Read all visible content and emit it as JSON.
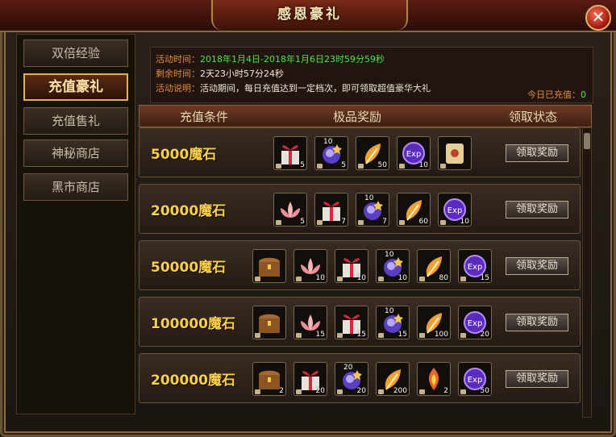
{
  "window": {
    "title": "感恩豪礼",
    "close_symbol": "✕"
  },
  "sidebar": {
    "items": [
      {
        "label": "双倍经验"
      },
      {
        "label": "充值豪礼",
        "active": true
      },
      {
        "label": "充值售礼"
      },
      {
        "label": "神秘商店"
      },
      {
        "label": "黑市商店"
      }
    ]
  },
  "info": {
    "time_label": "活动时间：",
    "time_value": "2018年1月4日-2018年1月6日23时59分59秒",
    "remain_label": "剩余时间：",
    "remain_value": "2天23小时57分24秒",
    "desc_label": "活动说明：",
    "desc_value": "活动期间，每日充值达到一定档次，即可领取超值豪华大礼",
    "today_label": "今日已充值：",
    "today_value": "0"
  },
  "table": {
    "headers": [
      "充值条件",
      "极品奖励",
      "领取状态"
    ],
    "claim_label": "领取奖励",
    "rows": [
      {
        "condition": "5000魔石",
        "items": [
          {
            "icon": "gift-box-icon",
            "count": "5"
          },
          {
            "icon": "soul-orb-icon",
            "count": "5",
            "level": "10"
          },
          {
            "icon": "feather-icon",
            "count": "50"
          },
          {
            "icon": "exp-orb-icon",
            "count": "10"
          },
          {
            "icon": "scroll-icon",
            "count": ""
          }
        ]
      },
      {
        "condition": "20000魔石",
        "items": [
          {
            "icon": "lotus-icon",
            "count": "5"
          },
          {
            "icon": "gift-box-icon",
            "count": "7"
          },
          {
            "icon": "soul-orb-icon",
            "count": "7",
            "level": "10"
          },
          {
            "icon": "feather-icon",
            "count": "60"
          },
          {
            "icon": "exp-orb-icon",
            "count": "10"
          }
        ]
      },
      {
        "condition": "50000魔石",
        "items": [
          {
            "icon": "treasure-chest-icon",
            "count": ""
          },
          {
            "icon": "lotus-icon",
            "count": "10"
          },
          {
            "icon": "gift-box-icon",
            "count": "10"
          },
          {
            "icon": "soul-orb-icon",
            "count": "10",
            "level": "10"
          },
          {
            "icon": "feather-icon",
            "count": "80"
          },
          {
            "icon": "exp-orb-icon",
            "count": "15"
          }
        ]
      },
      {
        "condition": "100000魔石",
        "items": [
          {
            "icon": "treasure-chest-icon",
            "count": ""
          },
          {
            "icon": "lotus-icon",
            "count": "15"
          },
          {
            "icon": "gift-box-icon",
            "count": "15"
          },
          {
            "icon": "soul-orb-icon",
            "count": "15",
            "level": "10"
          },
          {
            "icon": "feather-icon",
            "count": "100"
          },
          {
            "icon": "exp-orb-icon",
            "count": "20"
          }
        ]
      },
      {
        "condition": "200000魔石",
        "items": [
          {
            "icon": "treasure-chest-icon",
            "count": "2"
          },
          {
            "icon": "gift-box-icon",
            "count": "20"
          },
          {
            "icon": "soul-orb-icon",
            "count": "20",
            "level": "20"
          },
          {
            "icon": "feather-icon",
            "count": "200"
          },
          {
            "icon": "flame-gem-icon",
            "count": "2"
          },
          {
            "icon": "exp-orb-icon",
            "count": "50"
          }
        ]
      }
    ]
  },
  "colors": {
    "accent_gold": "#ffd14a",
    "highlight_green": "#4ee63e",
    "label_orange": "#e78a37"
  }
}
